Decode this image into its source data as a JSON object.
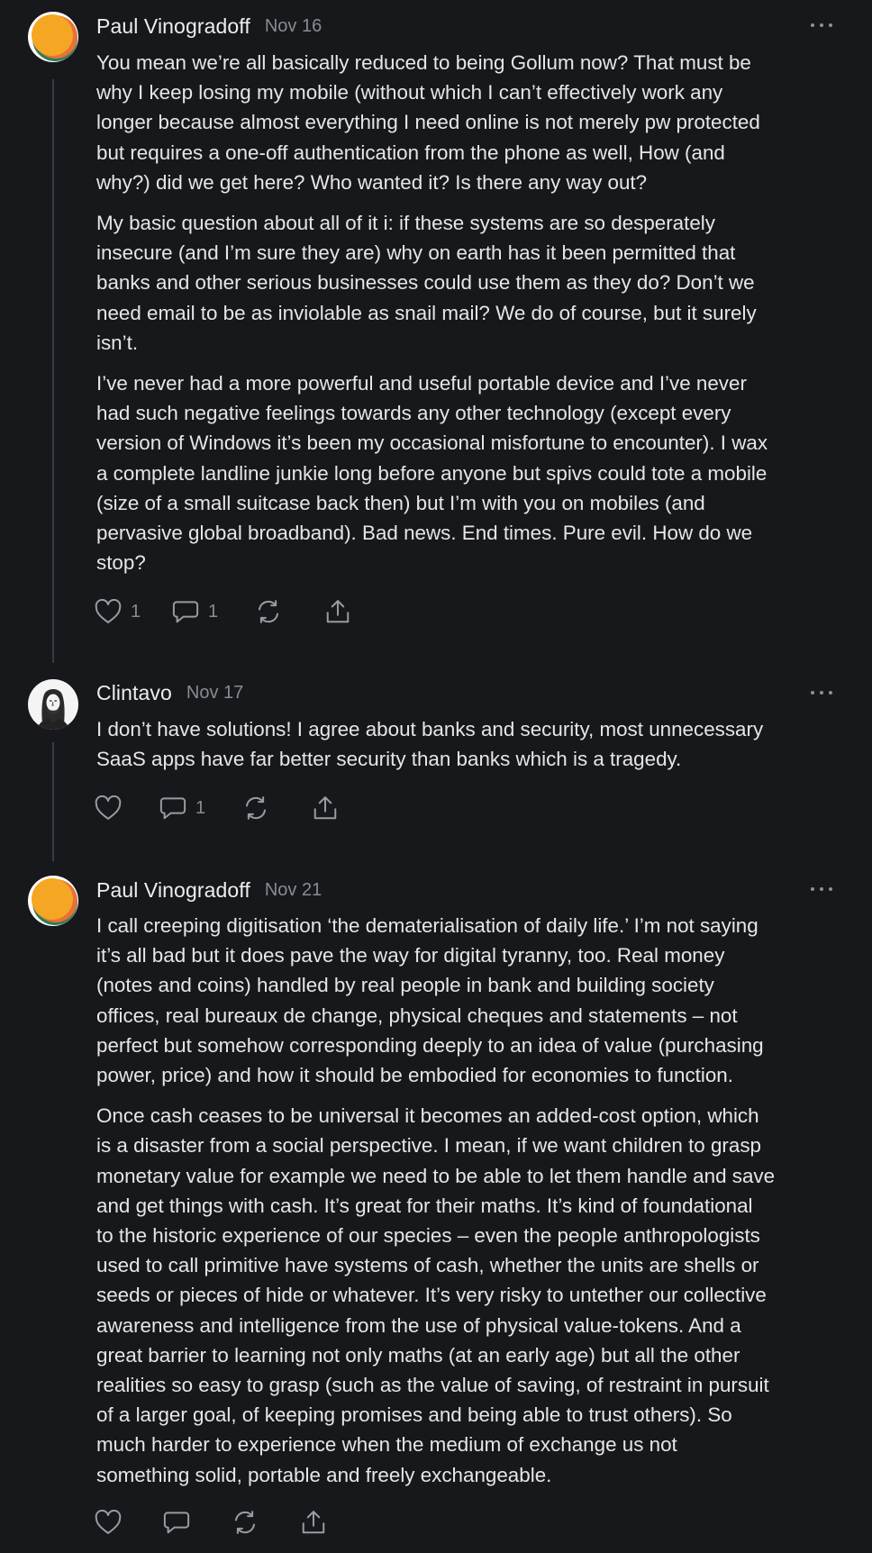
{
  "colors": {
    "background": "#17181b",
    "text": "#e6e6e8",
    "muted": "#8a8b90",
    "thread_line": "#3a3b40",
    "avatar_orange": "#f5a623",
    "avatar_green": "#2f7d57"
  },
  "comments": [
    {
      "author": "Paul Vinogradoff",
      "date": "Nov 16",
      "avatar_icon": "orange-circle-avatar",
      "paragraphs": [
        [
          "You mean we’re all basically reduced to being Gollum now? That must be",
          "why I keep losing my mobile (without which I can’t effectively work any",
          "longer because almost everything I need online is not merely pw protected",
          "but requires a one-off authentication from the phone as well, How (and",
          "why?) did we get here? Who wanted it? Is there any way out?"
        ],
        [
          "My basic question about all of it i: if these systems are so desperately",
          "insecure (and I’m sure they are) why on earth has it been permitted that",
          "banks and other serious businesses could use them as they do? Don’t we",
          "need email to be as inviolable as snail mail? We do of course, but it surely",
          "isn’t."
        ],
        [
          "I’ve never had a more powerful and useful portable device and I’ve never",
          "had such negative feelings towards any other technology (except every",
          "version of Windows it’s been my occasional misfortune to encounter). I wax",
          "a complete landline junkie long before anyone but spivs could tote a mobile",
          "(size of a small suitcase back then) but I’m with you on mobiles (and",
          "pervasive global broadband). Bad news. End times. Pure evil. How do we",
          "stop?"
        ]
      ],
      "like_count": "1",
      "reply_count": "1"
    },
    {
      "author": "Clintavo",
      "date": "Nov 17",
      "avatar_icon": "sketch-portrait-avatar",
      "paragraphs": [
        [
          "I don’t have solutions! I agree about banks and security, most unnecessary",
          "SaaS apps have far better security than banks which is a tragedy."
        ]
      ],
      "like_count": "",
      "reply_count": "1"
    },
    {
      "author": "Paul Vinogradoff",
      "date": "Nov 21",
      "avatar_icon": "orange-circle-avatar",
      "paragraphs": [
        [
          "I call creeping digitisation ‘the dematerialisation of daily life.’ I’m not saying",
          "it’s all bad but it does pave the way for digital tyranny, too. Real money",
          "(notes and coins) handled by real people in bank and building society",
          "offices, real bureaux de change, physical cheques and statements – not",
          "perfect but somehow corresponding deeply to an idea of value (purchasing",
          "power, price) and how it should be embodied for economies to function."
        ],
        [
          "Once cash ceases to be universal it becomes an added-cost option, which",
          "is a disaster from a social perspective. I mean, if we want children to grasp",
          "monetary value for example we need to be able to let them handle and save",
          "and get things with cash. It’s great for their maths. It’s kind of foundational",
          "to the historic experience of our species – even the people anthropologists",
          "used to call primitive have systems of cash, whether the units are shells or",
          "seeds or pieces of hide or whatever. It’s very risky to untether our collective",
          "awareness and intelligence from the use of physical value-tokens. And a",
          "great barrier to learning not only maths (at an early age) but all the other",
          "realities so easy to grasp (such as the value of saving, of restraint in pursuit",
          "of a larger goal, of keeping promises and being able to trust others). So",
          "much harder to experience when the medium of exchange us not",
          "something solid, portable and freely exchangeable."
        ]
      ],
      "like_count": "",
      "reply_count": ""
    }
  ]
}
